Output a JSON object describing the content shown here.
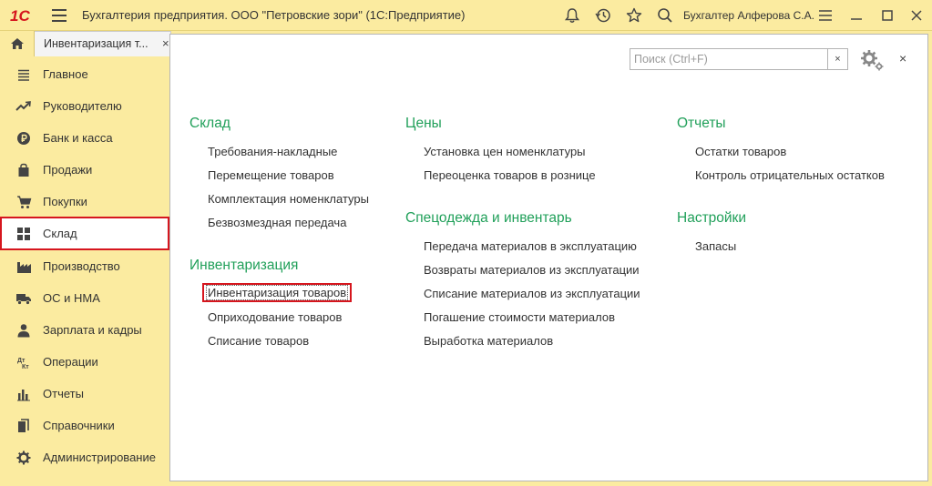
{
  "titlebar": {
    "logo_text": "1С",
    "title": "Бухгалтерия предприятия. ООО \"Петровские зори\"  (1С:Предприятие)",
    "icons": [
      "bell-icon",
      "history-icon",
      "star-icon",
      "search-icon"
    ],
    "user": "Бухгалтер Алферова С.А.",
    "window_buttons": [
      "settings-lines-icon",
      "minimize-icon",
      "maximize-icon",
      "close-icon"
    ]
  },
  "tabs": {
    "home_icon": "home-icon",
    "open_tab": {
      "label": "Инвентаризация т...",
      "close": "×"
    }
  },
  "sidebar": {
    "items": [
      {
        "label": "Главное",
        "icon": "menu-list-icon"
      },
      {
        "label": "Руководителю",
        "icon": "trend-icon"
      },
      {
        "label": "Банк и касса",
        "icon": "ruble-coin-icon"
      },
      {
        "label": "Продажи",
        "icon": "shopping-bag-icon"
      },
      {
        "label": "Покупки",
        "icon": "shopping-cart-icon"
      },
      {
        "label": "Склад",
        "icon": "warehouse-grid-icon",
        "active": true
      },
      {
        "label": "Производство",
        "icon": "factory-icon"
      },
      {
        "label": "ОС и НМА",
        "icon": "truck-icon"
      },
      {
        "label": "Зарплата и кадры",
        "icon": "people-icon"
      },
      {
        "label": "Операции",
        "icon": "debit-credit-icon"
      },
      {
        "label": "Отчеты",
        "icon": "bar-chart-icon"
      },
      {
        "label": "Справочники",
        "icon": "books-icon"
      },
      {
        "label": "Администрирование",
        "icon": "gear-icon"
      }
    ]
  },
  "main": {
    "search": {
      "placeholder": "Поиск (Ctrl+F)",
      "value": "",
      "clear": "×"
    },
    "close": "×",
    "colors": {
      "section": "#21a05a",
      "highlight": "#d6161e",
      "active_border": "#d6161e"
    },
    "sections": {
      "sklad": {
        "title": "Склад",
        "links": [
          "Требования-накладные",
          "Перемещение товаров",
          "Комплектация номенклатуры",
          "Безвозмездная передача"
        ]
      },
      "inventory": {
        "title": "Инвентаризация",
        "links": [
          "Инвентаризация товаров",
          "Оприходование товаров",
          "Списание товаров"
        ]
      },
      "prices": {
        "title": "Цены",
        "links": [
          "Установка цен номенклатуры",
          "Переоценка товаров в рознице"
        ]
      },
      "workwear": {
        "title": "Спецодежда и инвентарь",
        "links": [
          "Передача материалов в эксплуатацию",
          "Возвраты материалов из эксплуатации",
          "Списание материалов из эксплуатации",
          "Погашение стоимости материалов",
          "Выработка материалов"
        ]
      },
      "reports": {
        "title": "Отчеты",
        "links": [
          "Остатки товаров",
          "Контроль отрицательных остатков"
        ]
      },
      "settings": {
        "title": "Настройки",
        "links": [
          "Запасы"
        ]
      }
    }
  }
}
